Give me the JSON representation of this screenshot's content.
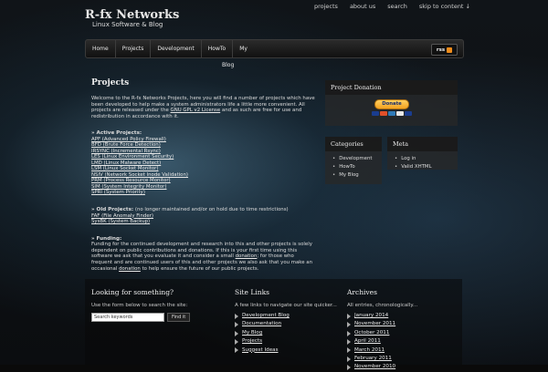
{
  "site": {
    "title": "R-fx Networks",
    "tagline": "Linux Software & Blog"
  },
  "topnav": [
    "projects",
    "about us",
    "search",
    "skip to content ↓"
  ],
  "nav": {
    "items": [
      "Home",
      "Projects",
      "Development",
      "HowTo",
      "My"
    ],
    "sub": "Blog",
    "rss": "rss"
  },
  "main": {
    "title": "Projects",
    "intro_before": "Welcome to the R-fx Networks Projects, here you will find a number of projects which have been developed to help make a system administrators life a little more convenient. All projects are released under the ",
    "intro_link": "GNU GPL v2 License",
    "intro_after": " and as such are free for use and redistribution in accordance with it.",
    "active_head": "» Active Projects:",
    "active": [
      "APF (Advanced Policy Firewall)",
      "BFD (Brute Force Detection)",
      "IRSYNC (Incremental Rsync)",
      "LES (Linux Environment Security)",
      "LMD (Linux Malware Detect)",
      "LSM (Linux Socket Monitor)",
      "NSIV (Network Socket Inode Validation)",
      "PRM (Process Resource Monitor)",
      "SIM (System Integrity Monitor)",
      "SPRI (System Priority)"
    ],
    "old_head": "» Old Projects:",
    "old_note": " (no longer maintained and/or on hold due to time restrictions)",
    "old": [
      "FAF (File Anomaly Finder)",
      "SysBK (System Backup)"
    ],
    "funding_head": "» Funding:",
    "funding_1": "Funding for the continued development and research into this and other projects is solely dependent on public contributions and donations. If this is your first time using this software we ask that you evaluate it and consider a small ",
    "funding_link1": "donation",
    "funding_2": "; for those who frequent and are continued users of this and other projects we also ask that you make an occasional ",
    "funding_link2": "donation",
    "funding_3": " to help ensure the future of our public projects."
  },
  "sidebar": {
    "donation_title": "Project Donation",
    "donate_label": "Donate",
    "categories_title": "Categories",
    "categories": [
      "Development",
      "HowTo",
      "My Blog"
    ],
    "meta_title": "Meta",
    "meta": [
      "Log in",
      "Valid XHTML"
    ]
  },
  "footer": {
    "search_title": "Looking for something?",
    "search_intro": "Use the form below to search the site:",
    "search_placeholder": "Search keywords",
    "search_button": "Find it",
    "links_title": "Site Links",
    "links_intro": "A few links to navigate our site quicker...",
    "links": [
      "Development Blog",
      "Documentation",
      "My Blog",
      "Projects",
      "Suggest Ideas"
    ],
    "archives_title": "Archives",
    "archives_intro": "All entries, chronologically...",
    "archives": [
      "January 2014",
      "November 2011",
      "October 2011",
      "April 2011",
      "March 2011",
      "February 2011",
      "November 2010"
    ]
  }
}
